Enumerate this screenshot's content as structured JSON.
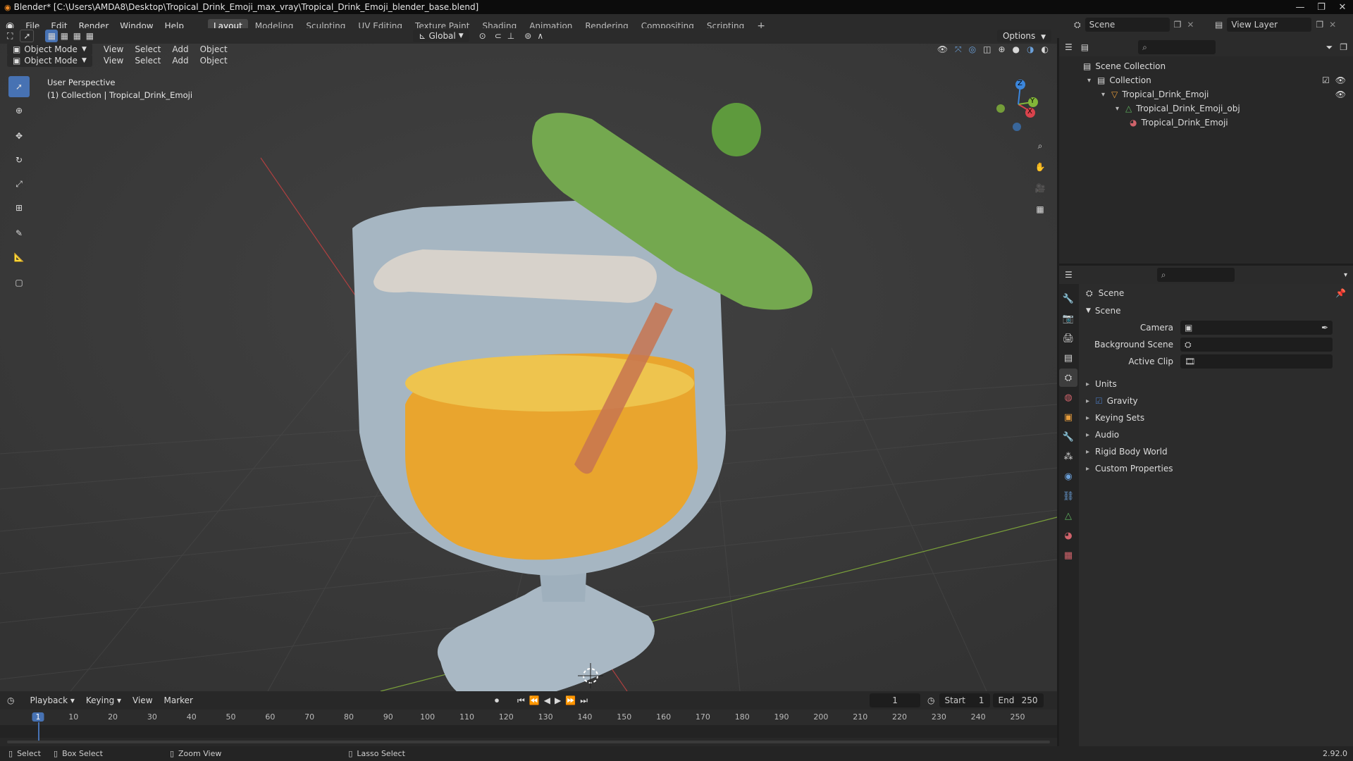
{
  "window": {
    "title": "Blender* [C:\\Users\\AMDA8\\Desktop\\Tropical_Drink_Emoji_max_vray\\Tropical_Drink_Emoji_blender_base.blend]",
    "minimize": "—",
    "maximize": "❐",
    "close": "✕"
  },
  "menus": [
    "File",
    "Edit",
    "Render",
    "Window",
    "Help"
  ],
  "workspaces": [
    "Layout",
    "Modeling",
    "Sculpting",
    "UV Editing",
    "Texture Paint",
    "Shading",
    "Animation",
    "Rendering",
    "Compositing",
    "Scripting"
  ],
  "active_workspace": "Layout",
  "scene_selector": {
    "value": "Scene"
  },
  "view_layer_selector": {
    "value": "View Layer"
  },
  "tool_header": {
    "transform_orientation": "Global",
    "options_label": "Options"
  },
  "viewport_header": {
    "mode": "Object Mode",
    "menus": [
      "View",
      "Select",
      "Add",
      "Object"
    ]
  },
  "viewport": {
    "perspective_label": "User Perspective",
    "collection_label": "(1) Collection | Tropical_Drink_Emoji",
    "gizmo_axes": {
      "x": "X",
      "y": "Y",
      "z": "Z"
    }
  },
  "colors": {
    "accent": "#4772b3",
    "juice": "#e9a52e",
    "umbrella": "#74a84f",
    "glass": "#a9b8c4",
    "straw": "#c77450"
  },
  "outliner": {
    "items": [
      {
        "label": "Scene Collection",
        "icon": "collection-icon",
        "indent": 0
      },
      {
        "label": "Collection",
        "icon": "collection-icon",
        "indent": 1
      },
      {
        "label": "Tropical_Drink_Emoji",
        "icon": "object-icon",
        "indent": 2
      },
      {
        "label": "Tropical_Drink_Emoji_obj",
        "icon": "mesh-icon",
        "indent": 3
      },
      {
        "label": "Tropical_Drink_Emoji",
        "icon": "material-icon",
        "indent": 4
      }
    ]
  },
  "properties": {
    "context": "Scene",
    "section": "Scene",
    "fields": [
      {
        "label": "Camera",
        "value": ""
      },
      {
        "label": "Background Scene",
        "value": ""
      },
      {
        "label": "Active Clip",
        "value": ""
      }
    ],
    "panels": [
      {
        "label": "Units",
        "checkbox": false
      },
      {
        "label": "Gravity",
        "checkbox": true
      },
      {
        "label": "Keying Sets",
        "checkbox": false
      },
      {
        "label": "Audio",
        "checkbox": false
      },
      {
        "label": "Rigid Body World",
        "checkbox": false
      },
      {
        "label": "Custom Properties",
        "checkbox": false
      }
    ]
  },
  "timeline": {
    "menus": [
      "Playback",
      "Keying",
      "View",
      "Marker"
    ],
    "current_frame": "1",
    "start_label": "Start",
    "start": "1",
    "end_label": "End",
    "end": "250",
    "ticks": [
      "1",
      "10",
      "20",
      "30",
      "40",
      "50",
      "60",
      "70",
      "80",
      "90",
      "100",
      "110",
      "120",
      "130",
      "140",
      "150",
      "160",
      "170",
      "180",
      "190",
      "200",
      "210",
      "220",
      "230",
      "240",
      "250"
    ]
  },
  "status_bar": {
    "select": "Select",
    "box_select": "Box Select",
    "zoom_view": "Zoom View",
    "lasso_select": "Lasso Select",
    "version": "2.92.0"
  }
}
